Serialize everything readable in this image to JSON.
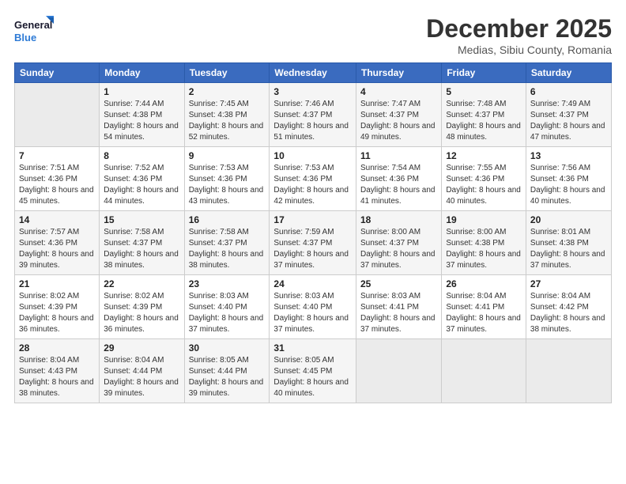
{
  "logo": {
    "line1": "General",
    "line2": "Blue"
  },
  "title": "December 2025",
  "subtitle": "Medias, Sibiu County, Romania",
  "days_of_week": [
    "Sunday",
    "Monday",
    "Tuesday",
    "Wednesday",
    "Thursday",
    "Friday",
    "Saturday"
  ],
  "weeks": [
    [
      {
        "num": "",
        "sunrise": "",
        "sunset": "",
        "daylight": ""
      },
      {
        "num": "1",
        "sunrise": "Sunrise: 7:44 AM",
        "sunset": "Sunset: 4:38 PM",
        "daylight": "Daylight: 8 hours and 54 minutes."
      },
      {
        "num": "2",
        "sunrise": "Sunrise: 7:45 AM",
        "sunset": "Sunset: 4:38 PM",
        "daylight": "Daylight: 8 hours and 52 minutes."
      },
      {
        "num": "3",
        "sunrise": "Sunrise: 7:46 AM",
        "sunset": "Sunset: 4:37 PM",
        "daylight": "Daylight: 8 hours and 51 minutes."
      },
      {
        "num": "4",
        "sunrise": "Sunrise: 7:47 AM",
        "sunset": "Sunset: 4:37 PM",
        "daylight": "Daylight: 8 hours and 49 minutes."
      },
      {
        "num": "5",
        "sunrise": "Sunrise: 7:48 AM",
        "sunset": "Sunset: 4:37 PM",
        "daylight": "Daylight: 8 hours and 48 minutes."
      },
      {
        "num": "6",
        "sunrise": "Sunrise: 7:49 AM",
        "sunset": "Sunset: 4:37 PM",
        "daylight": "Daylight: 8 hours and 47 minutes."
      }
    ],
    [
      {
        "num": "7",
        "sunrise": "Sunrise: 7:51 AM",
        "sunset": "Sunset: 4:36 PM",
        "daylight": "Daylight: 8 hours and 45 minutes."
      },
      {
        "num": "8",
        "sunrise": "Sunrise: 7:52 AM",
        "sunset": "Sunset: 4:36 PM",
        "daylight": "Daylight: 8 hours and 44 minutes."
      },
      {
        "num": "9",
        "sunrise": "Sunrise: 7:53 AM",
        "sunset": "Sunset: 4:36 PM",
        "daylight": "Daylight: 8 hours and 43 minutes."
      },
      {
        "num": "10",
        "sunrise": "Sunrise: 7:53 AM",
        "sunset": "Sunset: 4:36 PM",
        "daylight": "Daylight: 8 hours and 42 minutes."
      },
      {
        "num": "11",
        "sunrise": "Sunrise: 7:54 AM",
        "sunset": "Sunset: 4:36 PM",
        "daylight": "Daylight: 8 hours and 41 minutes."
      },
      {
        "num": "12",
        "sunrise": "Sunrise: 7:55 AM",
        "sunset": "Sunset: 4:36 PM",
        "daylight": "Daylight: 8 hours and 40 minutes."
      },
      {
        "num": "13",
        "sunrise": "Sunrise: 7:56 AM",
        "sunset": "Sunset: 4:36 PM",
        "daylight": "Daylight: 8 hours and 40 minutes."
      }
    ],
    [
      {
        "num": "14",
        "sunrise": "Sunrise: 7:57 AM",
        "sunset": "Sunset: 4:36 PM",
        "daylight": "Daylight: 8 hours and 39 minutes."
      },
      {
        "num": "15",
        "sunrise": "Sunrise: 7:58 AM",
        "sunset": "Sunset: 4:37 PM",
        "daylight": "Daylight: 8 hours and 38 minutes."
      },
      {
        "num": "16",
        "sunrise": "Sunrise: 7:58 AM",
        "sunset": "Sunset: 4:37 PM",
        "daylight": "Daylight: 8 hours and 38 minutes."
      },
      {
        "num": "17",
        "sunrise": "Sunrise: 7:59 AM",
        "sunset": "Sunset: 4:37 PM",
        "daylight": "Daylight: 8 hours and 37 minutes."
      },
      {
        "num": "18",
        "sunrise": "Sunrise: 8:00 AM",
        "sunset": "Sunset: 4:37 PM",
        "daylight": "Daylight: 8 hours and 37 minutes."
      },
      {
        "num": "19",
        "sunrise": "Sunrise: 8:00 AM",
        "sunset": "Sunset: 4:38 PM",
        "daylight": "Daylight: 8 hours and 37 minutes."
      },
      {
        "num": "20",
        "sunrise": "Sunrise: 8:01 AM",
        "sunset": "Sunset: 4:38 PM",
        "daylight": "Daylight: 8 hours and 37 minutes."
      }
    ],
    [
      {
        "num": "21",
        "sunrise": "Sunrise: 8:02 AM",
        "sunset": "Sunset: 4:39 PM",
        "daylight": "Daylight: 8 hours and 36 minutes."
      },
      {
        "num": "22",
        "sunrise": "Sunrise: 8:02 AM",
        "sunset": "Sunset: 4:39 PM",
        "daylight": "Daylight: 8 hours and 36 minutes."
      },
      {
        "num": "23",
        "sunrise": "Sunrise: 8:03 AM",
        "sunset": "Sunset: 4:40 PM",
        "daylight": "Daylight: 8 hours and 37 minutes."
      },
      {
        "num": "24",
        "sunrise": "Sunrise: 8:03 AM",
        "sunset": "Sunset: 4:40 PM",
        "daylight": "Daylight: 8 hours and 37 minutes."
      },
      {
        "num": "25",
        "sunrise": "Sunrise: 8:03 AM",
        "sunset": "Sunset: 4:41 PM",
        "daylight": "Daylight: 8 hours and 37 minutes."
      },
      {
        "num": "26",
        "sunrise": "Sunrise: 8:04 AM",
        "sunset": "Sunset: 4:41 PM",
        "daylight": "Daylight: 8 hours and 37 minutes."
      },
      {
        "num": "27",
        "sunrise": "Sunrise: 8:04 AM",
        "sunset": "Sunset: 4:42 PM",
        "daylight": "Daylight: 8 hours and 38 minutes."
      }
    ],
    [
      {
        "num": "28",
        "sunrise": "Sunrise: 8:04 AM",
        "sunset": "Sunset: 4:43 PM",
        "daylight": "Daylight: 8 hours and 38 minutes."
      },
      {
        "num": "29",
        "sunrise": "Sunrise: 8:04 AM",
        "sunset": "Sunset: 4:44 PM",
        "daylight": "Daylight: 8 hours and 39 minutes."
      },
      {
        "num": "30",
        "sunrise": "Sunrise: 8:05 AM",
        "sunset": "Sunset: 4:44 PM",
        "daylight": "Daylight: 8 hours and 39 minutes."
      },
      {
        "num": "31",
        "sunrise": "Sunrise: 8:05 AM",
        "sunset": "Sunset: 4:45 PM",
        "daylight": "Daylight: 8 hours and 40 minutes."
      },
      {
        "num": "",
        "sunrise": "",
        "sunset": "",
        "daylight": ""
      },
      {
        "num": "",
        "sunrise": "",
        "sunset": "",
        "daylight": ""
      },
      {
        "num": "",
        "sunrise": "",
        "sunset": "",
        "daylight": ""
      }
    ]
  ]
}
